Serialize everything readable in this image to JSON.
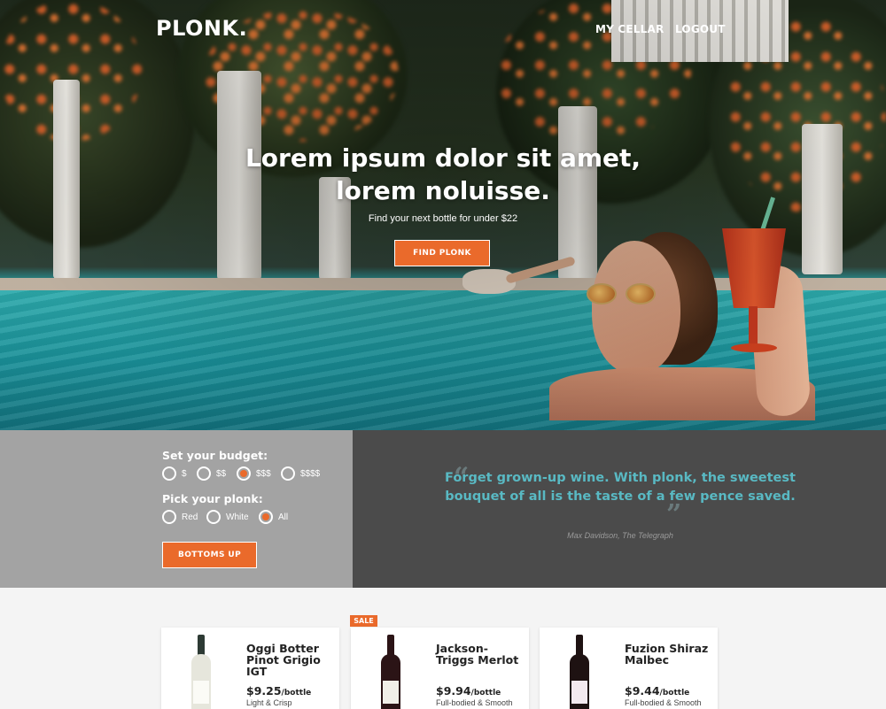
{
  "header": {
    "logo": "PLONK.",
    "nav": [
      "MY CELLAR",
      "LOGOUT"
    ]
  },
  "hero": {
    "title": "Lorem ipsum dolor sit amet, lorem noluisse.",
    "subtitle": "Find your next bottle for under $22",
    "cta": "FIND PLONK"
  },
  "filter": {
    "budget_heading": "Set your budget:",
    "budget_options": [
      "$",
      "$$",
      "$$$",
      "$$$$"
    ],
    "budget_selected": "$$$",
    "plonk_heading": "Pick your plonk:",
    "plonk_options": [
      "Red",
      "White",
      "All"
    ],
    "plonk_selected": "All",
    "button": "BOTTOMS UP"
  },
  "quote": {
    "text": "Forget grown-up wine. With plonk, the sweetest bouquet of all is the taste of a few pence saved.",
    "source": "Max Davidson, The Telegraph"
  },
  "products": [
    {
      "name": "Oggi Botter Pinot Grigio IGT",
      "price": "$9.25",
      "per": "/bottle",
      "desc": "Light & Crisp",
      "sale": false,
      "bottle_color": "#e6e6dc"
    },
    {
      "name": "Jackson-Triggs Merlot",
      "price": "$9.94",
      "per": "/bottle",
      "desc": "Full-bodied & Smooth",
      "sale": true,
      "badge": "SALE",
      "bottle_color": "#2b1416"
    },
    {
      "name": "Fuzion Shiraz Malbec",
      "price": "$9.44",
      "per": "/bottle",
      "desc": "Full-bodied & Smooth",
      "sale": false,
      "bottle_color": "#1e1212"
    }
  ],
  "colors": {
    "accent": "#ea6a2b",
    "quote_teal": "#59b9c3",
    "panel_gray": "#a3a3a3",
    "panel_dark": "#4b4b4b"
  }
}
